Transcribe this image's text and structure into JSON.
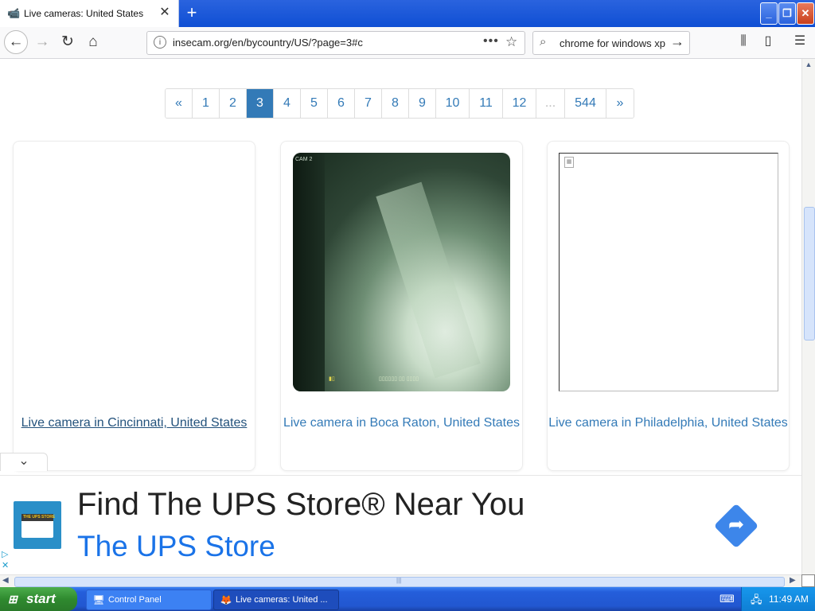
{
  "browser": {
    "tab_title": "Live cameras: United States",
    "tab_close": "✕",
    "new_tab": "+",
    "url": "insecam.org/en/bycountry/US/?page=3#c",
    "search_text": "chrome for windows xp",
    "window_controls": {
      "minimize": "_",
      "maximize": "❐",
      "close": "✕"
    }
  },
  "pagination": [
    "«",
    "1",
    "2",
    "3",
    "4",
    "5",
    "6",
    "7",
    "8",
    "9",
    "10",
    "11",
    "12",
    "...",
    "544",
    "»"
  ],
  "pagination_active": "3",
  "cameras": [
    {
      "caption": "Live camera in Cincinnati, United States"
    },
    {
      "caption": "Live camera in Boca Raton, United States",
      "overlay_label": "CAM 2"
    },
    {
      "caption": "Live camera in Philadelphia, United States"
    }
  ],
  "ad": {
    "headline": "Find The UPS Store® Near You",
    "brand": "The UPS Store",
    "logo_text": "THE UPS STORE"
  },
  "taskbar": {
    "start": "start",
    "tasks": [
      "Control Panel",
      "Live cameras: United ..."
    ],
    "clock": "11:49 AM"
  },
  "colors": {
    "link": "#337ab7",
    "active_page": "#337ab7",
    "ad_brand": "#1a73e8",
    "taskbar": "#245edb"
  }
}
